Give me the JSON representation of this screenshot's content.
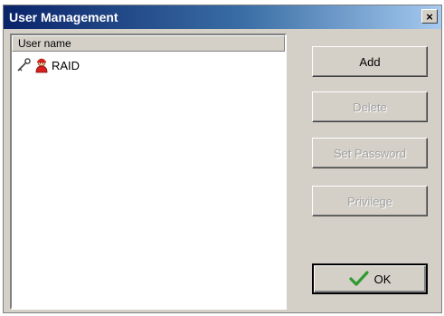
{
  "window": {
    "title": "User Management",
    "close_glyph": "×"
  },
  "list": {
    "column_header": "User name",
    "rows": [
      {
        "label": "RAID",
        "icons": [
          "key-icon",
          "user-icon"
        ]
      }
    ]
  },
  "buttons": {
    "add": "Add",
    "delete": "Delete",
    "set_password": "Set Password",
    "privilege": "Privilege",
    "ok": "OK"
  },
  "colors": {
    "title_bar_start": "#0a246a",
    "title_bar_end": "#a6caf0",
    "dialog_bg": "#d4d0c8",
    "ok_check": "#2e9a2e"
  }
}
